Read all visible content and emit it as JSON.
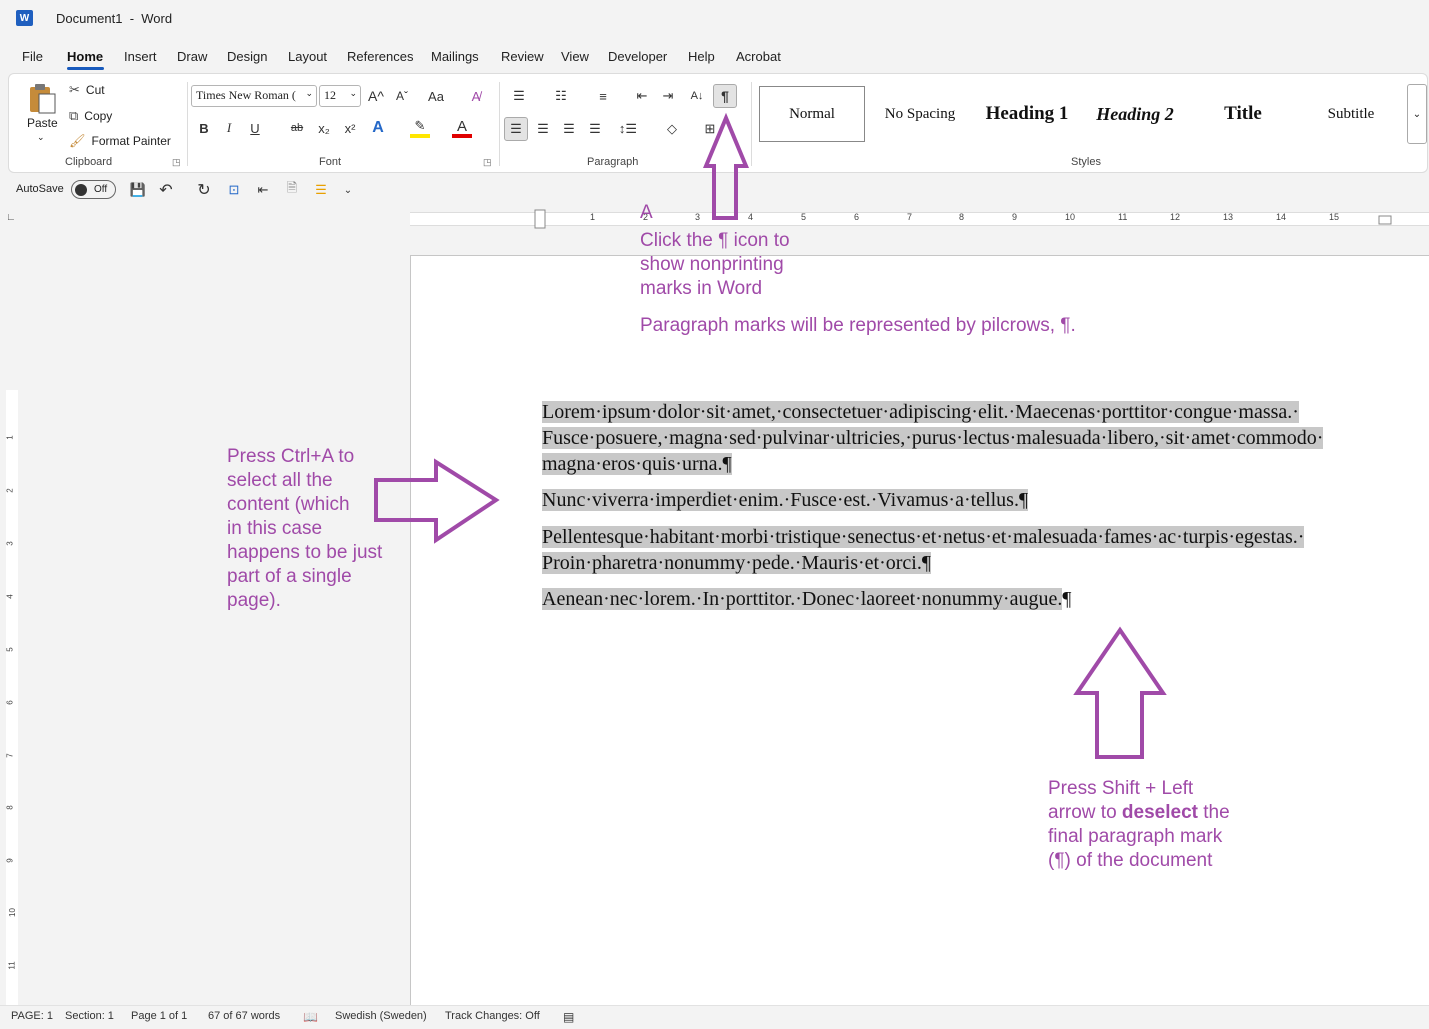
{
  "titlebar": {
    "doc_title": "Document1  -  Word",
    "app_icon": "word-logo"
  },
  "menu": [
    "File",
    "Home",
    "Insert",
    "Draw",
    "Design",
    "Layout",
    "References",
    "Mailings",
    "Review",
    "View",
    "Developer",
    "Help",
    "Acrobat"
  ],
  "ribbon": {
    "clipboard": {
      "paste": "Paste",
      "cut": "Cut",
      "copy": "Copy",
      "format_painter": "Format Painter",
      "label": "Clipboard"
    },
    "font": {
      "name": "Times New Roman (",
      "size": "12",
      "label": "Font",
      "bold": "B",
      "italic": "I",
      "underline": "U",
      "strike": "ab",
      "sub": "x₂",
      "sup": "x²",
      "grow": "A^",
      "shrink": "Aˇ",
      "case": "Aa"
    },
    "paragraph": {
      "label": "Paragraph",
      "pilcrow": "¶"
    },
    "styles": {
      "label": "Styles",
      "items": [
        "Normal",
        "No Spacing",
        "Heading 1",
        "Heading 2",
        "Title",
        "Subtitle"
      ]
    }
  },
  "qat": {
    "autosave": "AutoSave",
    "toggle": "Off"
  },
  "ruler": {
    "numbers": [
      "1",
      "1",
      "2",
      "3",
      "4",
      "5",
      "6",
      "7",
      "8",
      "9",
      "10",
      "11",
      "12",
      "13",
      "14",
      "15"
    ],
    "vnumbers": [
      "1",
      "2",
      "3",
      "4",
      "5",
      "6",
      "7",
      "8",
      "9",
      "10",
      "11"
    ]
  },
  "document": {
    "paragraphs": [
      {
        "lines": [
          "Lorem·ipsum·dolor·sit·amet,·consectetuer·adipiscing·elit.·Maecenas·porttitor·congue·massa.·",
          "Fusce·posuere,·magna·sed·pulvinar·ultricies,·purus·lectus·malesuada·libero,·sit·amet·commodo·",
          "magna·eros·quis·urna.¶"
        ]
      },
      {
        "lines": [
          "Nunc·viverra·imperdiet·enim.·Fusce·est.·Vivamus·a·tellus.¶"
        ]
      },
      {
        "lines": [
          "Pellentesque·habitant·morbi·tristique·senectus·et·netus·et·malesuada·fames·ac·turpis·egestas.·",
          "Proin·pharetra·nonummy·pede.·Mauris·et·orci.¶"
        ]
      },
      {
        "lines": [
          "Aenean·nec·lorem.·In·porttitor.·Donec·laoreet·nonummy·augue."
        ],
        "last_mark": "¶"
      }
    ]
  },
  "annotations": {
    "a_letter": "A",
    "pilcrow_tip": [
      "Click the ¶ icon to",
      "show nonprinting",
      "marks in Word"
    ],
    "pilcrow_note": "Paragraph marks will be represented by pilcrows, ¶.",
    "select_all": [
      "Press Ctrl+A to",
      "select all the",
      "content (which",
      "in this case",
      "happens to be just",
      "part of a single",
      "page)."
    ],
    "deselect_1": "Press Shift + Left",
    "deselect_2a": "arrow to ",
    "deselect_2b": "deselect",
    "deselect_2c": " the",
    "deselect_3": "final paragraph mark",
    "deselect_4": "(¶) of the document",
    "color": "#a04aa8"
  },
  "status": {
    "page": "PAGE: 1",
    "section": "Section: 1",
    "pages": "Page 1 of 1",
    "words": "67 of 67 words",
    "language": "Swedish (Sweden)",
    "track": "Track Changes: Off"
  }
}
